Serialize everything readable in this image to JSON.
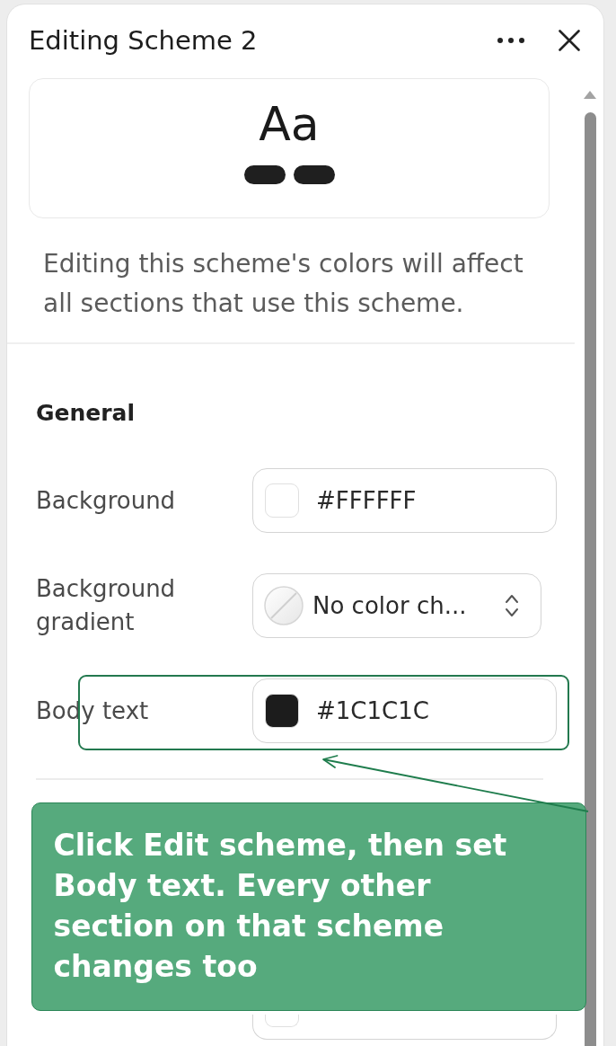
{
  "panel": {
    "title": "Editing Scheme 2"
  },
  "preview": {
    "sample_text": "Aa"
  },
  "description": "Editing this scheme's colors will affect all sections that use this scheme.",
  "sections": [
    {
      "heading": "General",
      "rows": [
        {
          "label": "Background",
          "kind": "color",
          "value": "#FFFFFF",
          "color": "#ffffff",
          "highlighted": false
        },
        {
          "label": "Background gradient",
          "kind": "select",
          "value": "No color ch...",
          "highlighted": false
        },
        {
          "label": "Body text",
          "kind": "color",
          "value": "#1C1C1C",
          "color": "#1c1c1c",
          "highlighted": true
        }
      ]
    }
  ],
  "callout": {
    "text": "Click Edit scheme, then set Body text. Every other section on that scheme changes too"
  }
}
